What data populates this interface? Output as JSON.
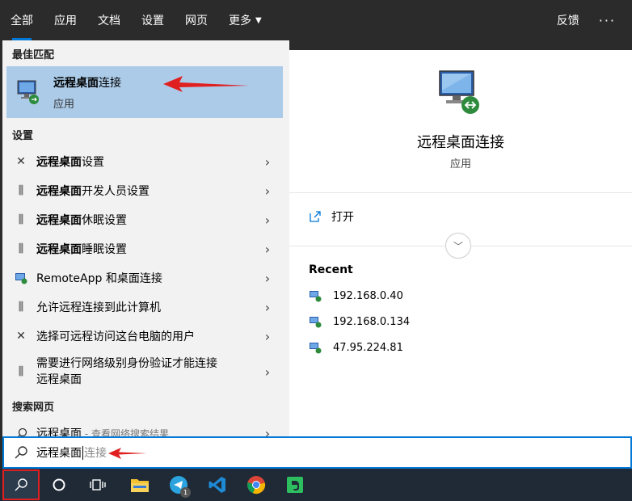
{
  "tabs": [
    {
      "label": "全部",
      "active": true
    },
    {
      "label": "应用"
    },
    {
      "label": "文档"
    },
    {
      "label": "设置"
    },
    {
      "label": "网页"
    },
    {
      "label": "更多"
    }
  ],
  "topbar": {
    "feedback": "反馈",
    "more_dots": "···"
  },
  "left": {
    "best_match_title": "最佳匹配",
    "best_match": {
      "name_bold": "远程桌面",
      "name_rest": "连接",
      "type": "应用"
    },
    "settings_title": "设置",
    "settings": [
      {
        "bold": "远程桌面",
        "rest": "设置",
        "icon": "remote-connect-icon"
      },
      {
        "bold": "远程桌面",
        "rest": "开发人员设置",
        "icon": "settings-slider-icon"
      },
      {
        "bold": "远程桌面",
        "rest": "休眠设置",
        "icon": "settings-slider-icon"
      },
      {
        "bold": "远程桌面",
        "rest": "睡眠设置",
        "icon": "settings-slider-icon"
      },
      {
        "bold": "",
        "rest": "RemoteApp 和桌面连接",
        "icon": "remoteapp-icon"
      },
      {
        "bold": "",
        "rest": "允许远程连接到此计算机",
        "icon": "settings-slider-icon"
      },
      {
        "bold": "",
        "rest": "选择可远程访问这台电脑的用户",
        "icon": "remote-connect-icon"
      }
    ],
    "tall_item": {
      "line1": "需要进行网络级别身份验证才能连接",
      "line2": "远程桌面"
    },
    "web_title": "搜索网页",
    "web_item": {
      "label": "远程桌面",
      "suffix": " - 查看网络搜索结果"
    }
  },
  "right": {
    "app_name": "远程桌面连接",
    "app_type": "应用",
    "open_label": "打开",
    "recent_title": "Recent",
    "recent": [
      "192.168.0.40",
      "192.168.0.134",
      "47.95.224.81"
    ]
  },
  "search": {
    "typed": "远程桌面",
    "suggestion": "连接"
  },
  "taskbar": {
    "apps": [
      "search-button",
      "cortana-button",
      "task-view-button",
      "file-explorer",
      "telegram",
      "vscode",
      "chrome",
      "evernote"
    ],
    "telegram_badge": "1"
  },
  "colors": {
    "accent": "#0078d7",
    "selected": "#accbe8",
    "annotation": "#e02020"
  }
}
